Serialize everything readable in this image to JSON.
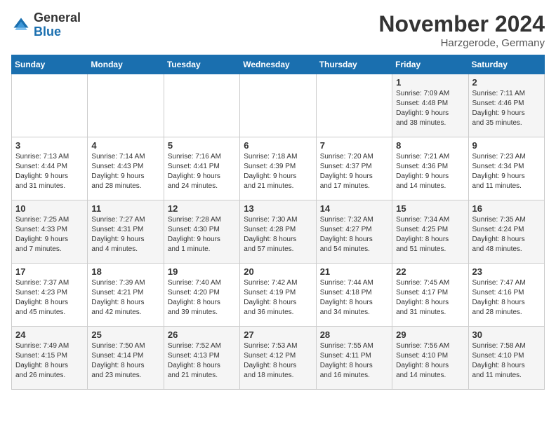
{
  "header": {
    "logo_general": "General",
    "logo_blue": "Blue",
    "month_year": "November 2024",
    "location": "Harzgerode, Germany"
  },
  "weekdays": [
    "Sunday",
    "Monday",
    "Tuesday",
    "Wednesday",
    "Thursday",
    "Friday",
    "Saturday"
  ],
  "weeks": [
    [
      {
        "day": "",
        "info": ""
      },
      {
        "day": "",
        "info": ""
      },
      {
        "day": "",
        "info": ""
      },
      {
        "day": "",
        "info": ""
      },
      {
        "day": "",
        "info": ""
      },
      {
        "day": "1",
        "info": "Sunrise: 7:09 AM\nSunset: 4:48 PM\nDaylight: 9 hours\nand 38 minutes."
      },
      {
        "day": "2",
        "info": "Sunrise: 7:11 AM\nSunset: 4:46 PM\nDaylight: 9 hours\nand 35 minutes."
      }
    ],
    [
      {
        "day": "3",
        "info": "Sunrise: 7:13 AM\nSunset: 4:44 PM\nDaylight: 9 hours\nand 31 minutes."
      },
      {
        "day": "4",
        "info": "Sunrise: 7:14 AM\nSunset: 4:43 PM\nDaylight: 9 hours\nand 28 minutes."
      },
      {
        "day": "5",
        "info": "Sunrise: 7:16 AM\nSunset: 4:41 PM\nDaylight: 9 hours\nand 24 minutes."
      },
      {
        "day": "6",
        "info": "Sunrise: 7:18 AM\nSunset: 4:39 PM\nDaylight: 9 hours\nand 21 minutes."
      },
      {
        "day": "7",
        "info": "Sunrise: 7:20 AM\nSunset: 4:37 PM\nDaylight: 9 hours\nand 17 minutes."
      },
      {
        "day": "8",
        "info": "Sunrise: 7:21 AM\nSunset: 4:36 PM\nDaylight: 9 hours\nand 14 minutes."
      },
      {
        "day": "9",
        "info": "Sunrise: 7:23 AM\nSunset: 4:34 PM\nDaylight: 9 hours\nand 11 minutes."
      }
    ],
    [
      {
        "day": "10",
        "info": "Sunrise: 7:25 AM\nSunset: 4:33 PM\nDaylight: 9 hours\nand 7 minutes."
      },
      {
        "day": "11",
        "info": "Sunrise: 7:27 AM\nSunset: 4:31 PM\nDaylight: 9 hours\nand 4 minutes."
      },
      {
        "day": "12",
        "info": "Sunrise: 7:28 AM\nSunset: 4:30 PM\nDaylight: 9 hours\nand 1 minute."
      },
      {
        "day": "13",
        "info": "Sunrise: 7:30 AM\nSunset: 4:28 PM\nDaylight: 8 hours\nand 57 minutes."
      },
      {
        "day": "14",
        "info": "Sunrise: 7:32 AM\nSunset: 4:27 PM\nDaylight: 8 hours\nand 54 minutes."
      },
      {
        "day": "15",
        "info": "Sunrise: 7:34 AM\nSunset: 4:25 PM\nDaylight: 8 hours\nand 51 minutes."
      },
      {
        "day": "16",
        "info": "Sunrise: 7:35 AM\nSunset: 4:24 PM\nDaylight: 8 hours\nand 48 minutes."
      }
    ],
    [
      {
        "day": "17",
        "info": "Sunrise: 7:37 AM\nSunset: 4:23 PM\nDaylight: 8 hours\nand 45 minutes."
      },
      {
        "day": "18",
        "info": "Sunrise: 7:39 AM\nSunset: 4:21 PM\nDaylight: 8 hours\nand 42 minutes."
      },
      {
        "day": "19",
        "info": "Sunrise: 7:40 AM\nSunset: 4:20 PM\nDaylight: 8 hours\nand 39 minutes."
      },
      {
        "day": "20",
        "info": "Sunrise: 7:42 AM\nSunset: 4:19 PM\nDaylight: 8 hours\nand 36 minutes."
      },
      {
        "day": "21",
        "info": "Sunrise: 7:44 AM\nSunset: 4:18 PM\nDaylight: 8 hours\nand 34 minutes."
      },
      {
        "day": "22",
        "info": "Sunrise: 7:45 AM\nSunset: 4:17 PM\nDaylight: 8 hours\nand 31 minutes."
      },
      {
        "day": "23",
        "info": "Sunrise: 7:47 AM\nSunset: 4:16 PM\nDaylight: 8 hours\nand 28 minutes."
      }
    ],
    [
      {
        "day": "24",
        "info": "Sunrise: 7:49 AM\nSunset: 4:15 PM\nDaylight: 8 hours\nand 26 minutes."
      },
      {
        "day": "25",
        "info": "Sunrise: 7:50 AM\nSunset: 4:14 PM\nDaylight: 8 hours\nand 23 minutes."
      },
      {
        "day": "26",
        "info": "Sunrise: 7:52 AM\nSunset: 4:13 PM\nDaylight: 8 hours\nand 21 minutes."
      },
      {
        "day": "27",
        "info": "Sunrise: 7:53 AM\nSunset: 4:12 PM\nDaylight: 8 hours\nand 18 minutes."
      },
      {
        "day": "28",
        "info": "Sunrise: 7:55 AM\nSunset: 4:11 PM\nDaylight: 8 hours\nand 16 minutes."
      },
      {
        "day": "29",
        "info": "Sunrise: 7:56 AM\nSunset: 4:10 PM\nDaylight: 8 hours\nand 14 minutes."
      },
      {
        "day": "30",
        "info": "Sunrise: 7:58 AM\nSunset: 4:10 PM\nDaylight: 8 hours\nand 11 minutes."
      }
    ]
  ]
}
